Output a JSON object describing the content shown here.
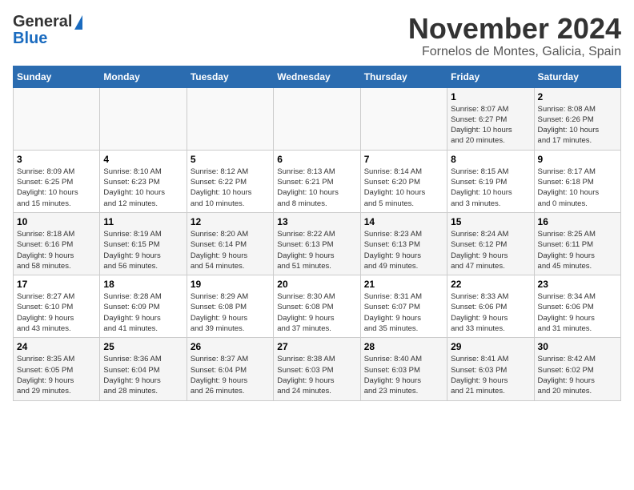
{
  "header": {
    "logo_line1": "General",
    "logo_line2": "Blue",
    "title": "November 2024",
    "subtitle": "Fornelos de Montes, Galicia, Spain"
  },
  "calendar": {
    "days_of_week": [
      "Sunday",
      "Monday",
      "Tuesday",
      "Wednesday",
      "Thursday",
      "Friday",
      "Saturday"
    ],
    "weeks": [
      [
        {
          "day": "",
          "info": ""
        },
        {
          "day": "",
          "info": ""
        },
        {
          "day": "",
          "info": ""
        },
        {
          "day": "",
          "info": ""
        },
        {
          "day": "",
          "info": ""
        },
        {
          "day": "1",
          "info": "Sunrise: 8:07 AM\nSunset: 6:27 PM\nDaylight: 10 hours\nand 20 minutes."
        },
        {
          "day": "2",
          "info": "Sunrise: 8:08 AM\nSunset: 6:26 PM\nDaylight: 10 hours\nand 17 minutes."
        }
      ],
      [
        {
          "day": "3",
          "info": "Sunrise: 8:09 AM\nSunset: 6:25 PM\nDaylight: 10 hours\nand 15 minutes."
        },
        {
          "day": "4",
          "info": "Sunrise: 8:10 AM\nSunset: 6:23 PM\nDaylight: 10 hours\nand 12 minutes."
        },
        {
          "day": "5",
          "info": "Sunrise: 8:12 AM\nSunset: 6:22 PM\nDaylight: 10 hours\nand 10 minutes."
        },
        {
          "day": "6",
          "info": "Sunrise: 8:13 AM\nSunset: 6:21 PM\nDaylight: 10 hours\nand 8 minutes."
        },
        {
          "day": "7",
          "info": "Sunrise: 8:14 AM\nSunset: 6:20 PM\nDaylight: 10 hours\nand 5 minutes."
        },
        {
          "day": "8",
          "info": "Sunrise: 8:15 AM\nSunset: 6:19 PM\nDaylight: 10 hours\nand 3 minutes."
        },
        {
          "day": "9",
          "info": "Sunrise: 8:17 AM\nSunset: 6:18 PM\nDaylight: 10 hours\nand 0 minutes."
        }
      ],
      [
        {
          "day": "10",
          "info": "Sunrise: 8:18 AM\nSunset: 6:16 PM\nDaylight: 9 hours\nand 58 minutes."
        },
        {
          "day": "11",
          "info": "Sunrise: 8:19 AM\nSunset: 6:15 PM\nDaylight: 9 hours\nand 56 minutes."
        },
        {
          "day": "12",
          "info": "Sunrise: 8:20 AM\nSunset: 6:14 PM\nDaylight: 9 hours\nand 54 minutes."
        },
        {
          "day": "13",
          "info": "Sunrise: 8:22 AM\nSunset: 6:13 PM\nDaylight: 9 hours\nand 51 minutes."
        },
        {
          "day": "14",
          "info": "Sunrise: 8:23 AM\nSunset: 6:13 PM\nDaylight: 9 hours\nand 49 minutes."
        },
        {
          "day": "15",
          "info": "Sunrise: 8:24 AM\nSunset: 6:12 PM\nDaylight: 9 hours\nand 47 minutes."
        },
        {
          "day": "16",
          "info": "Sunrise: 8:25 AM\nSunset: 6:11 PM\nDaylight: 9 hours\nand 45 minutes."
        }
      ],
      [
        {
          "day": "17",
          "info": "Sunrise: 8:27 AM\nSunset: 6:10 PM\nDaylight: 9 hours\nand 43 minutes."
        },
        {
          "day": "18",
          "info": "Sunrise: 8:28 AM\nSunset: 6:09 PM\nDaylight: 9 hours\nand 41 minutes."
        },
        {
          "day": "19",
          "info": "Sunrise: 8:29 AM\nSunset: 6:08 PM\nDaylight: 9 hours\nand 39 minutes."
        },
        {
          "day": "20",
          "info": "Sunrise: 8:30 AM\nSunset: 6:08 PM\nDaylight: 9 hours\nand 37 minutes."
        },
        {
          "day": "21",
          "info": "Sunrise: 8:31 AM\nSunset: 6:07 PM\nDaylight: 9 hours\nand 35 minutes."
        },
        {
          "day": "22",
          "info": "Sunrise: 8:33 AM\nSunset: 6:06 PM\nDaylight: 9 hours\nand 33 minutes."
        },
        {
          "day": "23",
          "info": "Sunrise: 8:34 AM\nSunset: 6:06 PM\nDaylight: 9 hours\nand 31 minutes."
        }
      ],
      [
        {
          "day": "24",
          "info": "Sunrise: 8:35 AM\nSunset: 6:05 PM\nDaylight: 9 hours\nand 29 minutes."
        },
        {
          "day": "25",
          "info": "Sunrise: 8:36 AM\nSunset: 6:04 PM\nDaylight: 9 hours\nand 28 minutes."
        },
        {
          "day": "26",
          "info": "Sunrise: 8:37 AM\nSunset: 6:04 PM\nDaylight: 9 hours\nand 26 minutes."
        },
        {
          "day": "27",
          "info": "Sunrise: 8:38 AM\nSunset: 6:03 PM\nDaylight: 9 hours\nand 24 minutes."
        },
        {
          "day": "28",
          "info": "Sunrise: 8:40 AM\nSunset: 6:03 PM\nDaylight: 9 hours\nand 23 minutes."
        },
        {
          "day": "29",
          "info": "Sunrise: 8:41 AM\nSunset: 6:03 PM\nDaylight: 9 hours\nand 21 minutes."
        },
        {
          "day": "30",
          "info": "Sunrise: 8:42 AM\nSunset: 6:02 PM\nDaylight: 9 hours\nand 20 minutes."
        }
      ]
    ]
  }
}
